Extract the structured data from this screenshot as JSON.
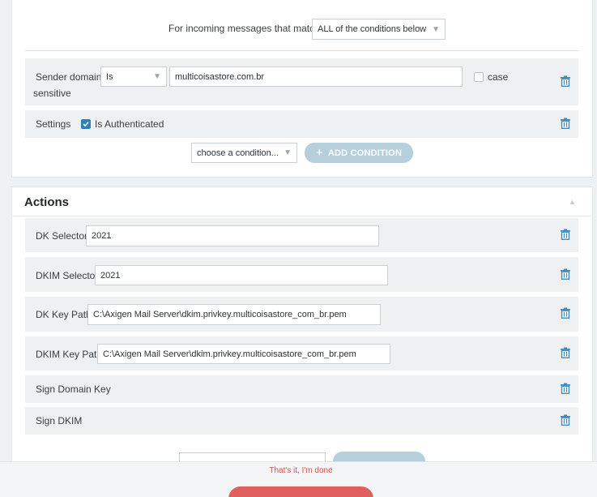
{
  "conditions": {
    "match_prefix": "For incoming messages that match",
    "match_select": "ALL of the conditions below",
    "rows": [
      {
        "label": "Sender domain",
        "operator": "Is",
        "value": "multicoisastore.com.br",
        "case_label": "case",
        "case_label2": "sensitive"
      },
      {
        "label": "Settings",
        "checkbox_label": "Is Authenticated"
      }
    ],
    "choose_placeholder": "choose a condition...",
    "add_button": "ADD CONDITION"
  },
  "actions": {
    "title": "Actions",
    "rows": [
      {
        "label": "DK Selector",
        "value": "2021"
      },
      {
        "label": "DKIM Selector",
        "value": "2021"
      },
      {
        "label": "DK Key Path",
        "value": "C:\\Axigen Mail Server\\dkim.privkey.multicoisastore_com_br.pem"
      },
      {
        "label": "DKIM Key Path",
        "value": "C:\\Axigen Mail Server\\dkim.privkey.multicoisastore_com_br.pem"
      },
      {
        "label": "Sign Domain Key"
      },
      {
        "label": "Sign DKIM"
      }
    ]
  },
  "footer": {
    "done_link": "That's it, I'm done"
  },
  "colors": {
    "accent": "#2f80b6",
    "danger": "#e06060",
    "button_disabled": "#b5d0dc"
  },
  "icons": {
    "delete": "trash-icon",
    "checkbox": "check-icon",
    "collapse": "triangle-up-icon",
    "dropdown": "chevron-down-icon",
    "add": "plus-icon"
  }
}
